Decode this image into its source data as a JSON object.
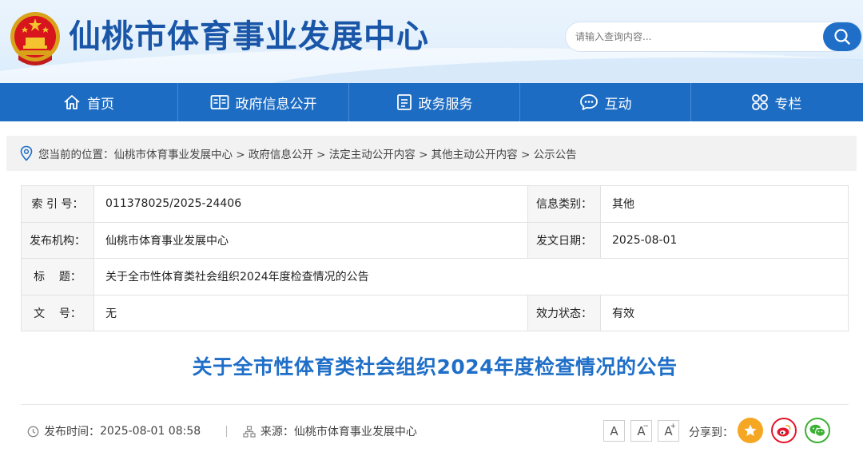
{
  "header": {
    "site_title": "仙桃市体育事业发展中心",
    "search_placeholder": "请输入查询内容..."
  },
  "nav": [
    {
      "label": "首页",
      "icon": "home-icon"
    },
    {
      "label": "政府信息公开",
      "icon": "info-open-icon"
    },
    {
      "label": "政务服务",
      "icon": "service-icon"
    },
    {
      "label": "互动",
      "icon": "chat-icon"
    },
    {
      "label": "专栏",
      "icon": "column-icon"
    }
  ],
  "breadcrumb": {
    "prefix": "您当前的位置：",
    "path": "仙桃市体育事业发展中心 > 政府信息公开 > 法定主动公开内容 > 其他主动公开内容 > 公示公告"
  },
  "meta": {
    "index_label": "索 引 号：",
    "index_value": "011378025/2025-24406",
    "category_label": "信息类别：",
    "category_value": "其他",
    "publisher_label": "发布机构：",
    "publisher_value": "仙桃市体育事业发展中心",
    "date_label": "发文日期：",
    "date_value": "2025-08-01",
    "title_label": "标    题：",
    "title_value": "关于全市性体育类社会组织2024年度检查情况的公告",
    "doc_no_label": "文    号：",
    "doc_no_value": "无",
    "status_label": "效力状态：",
    "status_value": "有效"
  },
  "article": {
    "title": "关于全市性体育类社会组织2024年度检查情况的公告",
    "publish_time_label": "发布时间：",
    "publish_time": "2025-08-01 08:58",
    "separator": "|",
    "source_label": "来源：",
    "source": "仙桃市体育事业发展中心"
  },
  "toolbar": {
    "font_large": "A",
    "font_medium": "A",
    "font_small": "A",
    "share_label": "分享到："
  },
  "colors": {
    "brand_blue": "#1d6cc3",
    "title_blue": "#1a56a8",
    "share_star": "#f5a623",
    "share_weibo": "#e6162d",
    "share_wechat": "#3cb034"
  }
}
